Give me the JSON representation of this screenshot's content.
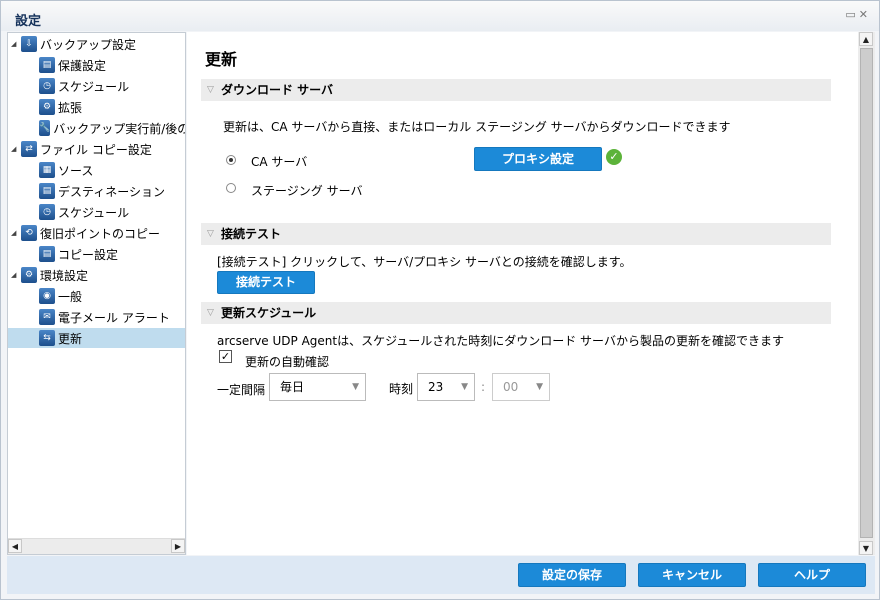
{
  "window": {
    "title": "設定"
  },
  "tree": [
    {
      "label": "バックアップ設定",
      "level": 0,
      "icon": "backup-icon"
    },
    {
      "label": "保護設定",
      "level": 1,
      "icon": "destination-icon"
    },
    {
      "label": "スケジュール",
      "level": 1,
      "icon": "schedule-icon"
    },
    {
      "label": "拡張",
      "level": 1,
      "icon": "advanced-icon"
    },
    {
      "label": "バックアップ実行前/後の",
      "level": 1,
      "icon": "wrench-icon"
    },
    {
      "label": "ファイル コピー設定",
      "level": 0,
      "icon": "file-copy-icon"
    },
    {
      "label": "ソース",
      "level": 1,
      "icon": "source-icon"
    },
    {
      "label": "デスティネーション",
      "level": 1,
      "icon": "destination-icon"
    },
    {
      "label": "スケジュール",
      "level": 1,
      "icon": "schedule-icon"
    },
    {
      "label": "復旧ポイントのコピー",
      "level": 0,
      "icon": "recovery-copy-icon"
    },
    {
      "label": "コピー設定",
      "level": 1,
      "icon": "destination-icon"
    },
    {
      "label": "環境設定",
      "level": 0,
      "icon": "gears-icon"
    },
    {
      "label": "一般",
      "level": 1,
      "icon": "globe-icon"
    },
    {
      "label": "電子メール アラート",
      "level": 1,
      "icon": "mail-icon"
    },
    {
      "label": "更新",
      "level": 1,
      "icon": "update-icon",
      "selected": true
    }
  ],
  "main": {
    "title": "更新",
    "download": {
      "header": "ダウンロード サーバ",
      "desc": "更新は、CA サーバから直接、またはローカル ステージング サーバからダウンロードできます",
      "opt_ca": "CA サーバ",
      "opt_staging": "ステージング サーバ",
      "proxy_button": "プロキシ設定",
      "selected": "CA サーバ"
    },
    "conn": {
      "header": "接続テスト",
      "desc": "[接続テスト] クリックして、サーバ/プロキシ サーバとの接続を確認します。",
      "button": "接続テスト"
    },
    "schedule": {
      "header": "更新スケジュール",
      "desc": "arcserve UDP Agentは、スケジュールされた時刻にダウンロード サーバから製品の更新を確認できます",
      "auto_check": "更新の自動確認",
      "auto_checked": true,
      "interval_label": "一定間隔",
      "interval_value": "毎日",
      "time_label": "時刻",
      "hour": "23",
      "colon": ":",
      "minute": "00"
    }
  },
  "footer": {
    "save": "設定の保存",
    "cancel": "キャンセル",
    "help": "ヘルプ"
  }
}
